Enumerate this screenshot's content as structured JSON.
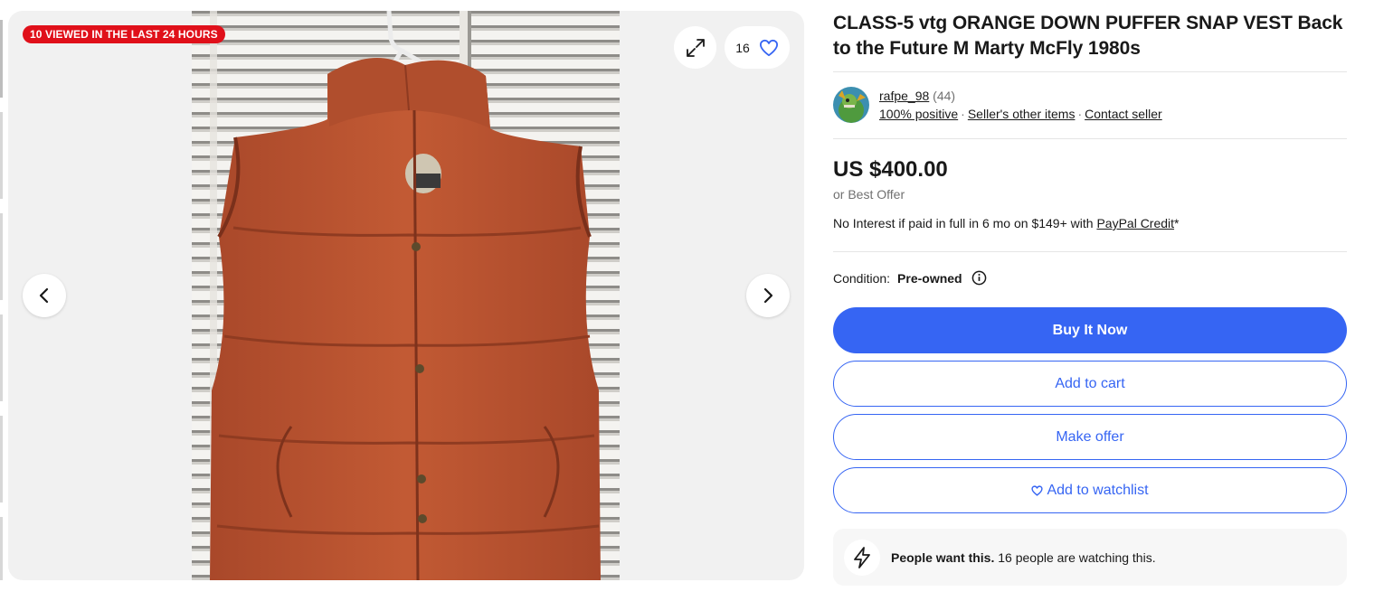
{
  "gallery": {
    "badge": "10 VIEWED IN THE LAST 24 HOURS",
    "watch_count": "16",
    "icons": {
      "expand": "expand-icon",
      "watch": "heart-icon",
      "prev": "chevron-left-icon",
      "next": "chevron-right-icon"
    }
  },
  "listing": {
    "title": "CLASS-5 vtg ORANGE DOWN PUFFER SNAP VEST Back to the Future M Marty McFly 1980s"
  },
  "seller": {
    "name": "rafpe_98",
    "feedback_count": "(44)",
    "positive": "100% positive",
    "other_items": "Seller's other items",
    "contact": "Contact seller"
  },
  "price": {
    "amount": "US $400.00",
    "best_offer": "or Best Offer",
    "credit_prefix": "No Interest if paid in full in 6 mo on $149+ with ",
    "credit_link": "PayPal Credit",
    "credit_suffix": "*"
  },
  "condition": {
    "label": "Condition:",
    "value": "Pre-owned"
  },
  "actions": {
    "buy_now": "Buy It Now",
    "add_to_cart": "Add to cart",
    "make_offer": "Make offer",
    "watchlist": "Add to watchlist"
  },
  "signal": {
    "strong": "People want this.",
    "text": " 16 people are watching this."
  },
  "colors": {
    "primary": "#3665f3",
    "badge": "#e0101a",
    "vest": "#b8522e"
  }
}
